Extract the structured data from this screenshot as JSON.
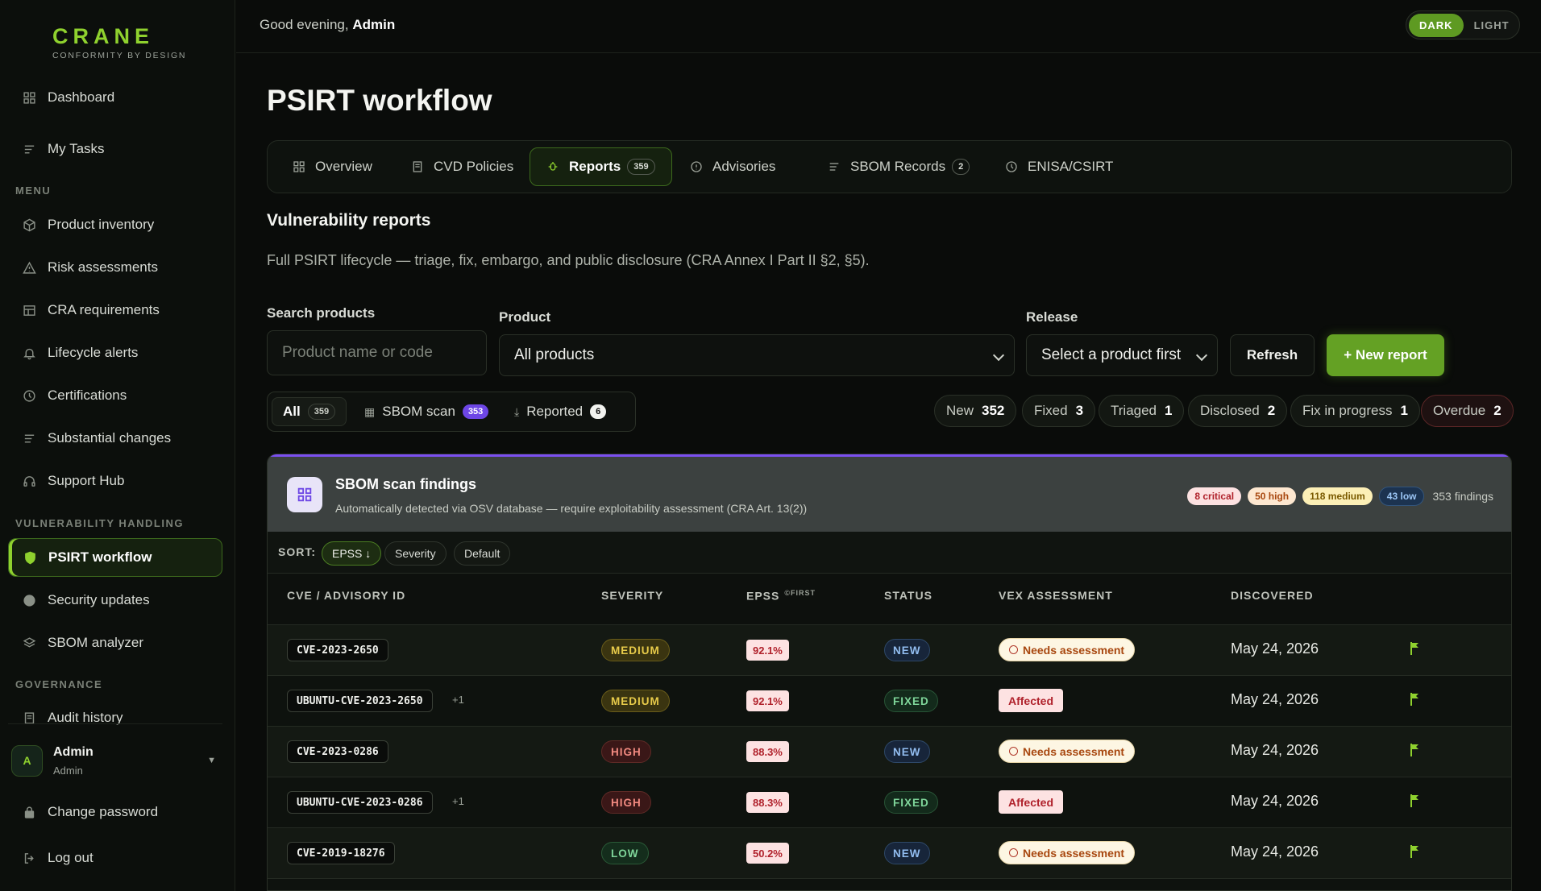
{
  "brand": {
    "name": "CRANE",
    "tagline": "CONFORMITY BY DESIGN"
  },
  "sidebar": {
    "top": [
      {
        "label": "Dashboard",
        "icon": "grid-icon"
      },
      {
        "label": "My Tasks",
        "icon": "list-icon"
      }
    ],
    "sections": [
      {
        "label": "MENU",
        "items": [
          {
            "label": "Product inventory"
          },
          {
            "label": "Risk assessments"
          },
          {
            "label": "CRA requirements"
          },
          {
            "label": "Lifecycle alerts"
          },
          {
            "label": "Certifications"
          },
          {
            "label": "Substantial changes"
          },
          {
            "label": "Support Hub"
          }
        ]
      },
      {
        "label": "VULNERABILITY HANDLING",
        "items": [
          {
            "label": "PSIRT workflow"
          },
          {
            "label": "Security updates"
          },
          {
            "label": "SBOM analyzer"
          }
        ]
      },
      {
        "label": "GOVERNANCE",
        "items": [
          {
            "label": "Audit history"
          }
        ]
      }
    ],
    "user": {
      "initial": "A",
      "name": "Admin",
      "role": "Admin"
    },
    "bottom": [
      {
        "label": "Change password"
      },
      {
        "label": "Log out"
      }
    ]
  },
  "topbar": {
    "greeting": "Good evening,",
    "user": "Admin",
    "theme": {
      "dark": "DARK",
      "light": "LIGHT",
      "selected": "DARK"
    }
  },
  "page": {
    "title": "PSIRT workflow"
  },
  "tabs": [
    {
      "label": "Overview"
    },
    {
      "label": "CVD Policies"
    },
    {
      "label": "Reports",
      "count": "359",
      "active": true
    },
    {
      "label": "Advisories"
    },
    {
      "label": "SBOM Records",
      "count": "2"
    },
    {
      "label": "ENISA/CSIRT"
    }
  ],
  "section": {
    "title": "Vulnerability reports",
    "description": "Full PSIRT lifecycle — triage, fix, embargo, and public disclosure (CRA Annex I Part II §2, §5)."
  },
  "filters": {
    "search_label": "Search products",
    "search_placeholder": "Product name or code",
    "product_label": "Product",
    "product_value": "All products",
    "release_label": "Release",
    "release_value": "Select a product first",
    "refresh": "Refresh",
    "new_report": "+ New report"
  },
  "source_tabs": [
    {
      "label": "All",
      "count": "359"
    },
    {
      "label": "SBOM scan",
      "count": "353"
    },
    {
      "label": "Reported",
      "count": "6"
    }
  ],
  "status_chips": [
    {
      "label": "New",
      "count": "352"
    },
    {
      "label": "Fixed",
      "count": "3"
    },
    {
      "label": "Triaged",
      "count": "1"
    },
    {
      "label": "Disclosed",
      "count": "2"
    },
    {
      "label": "Fix in progress",
      "count": "1"
    },
    {
      "label": "Overdue",
      "count": "2"
    }
  ],
  "findings": {
    "title": "SBOM scan findings",
    "subtitle": "Automatically detected via OSV database — require exploitability assessment (CRA Art. 13(2))",
    "critical": "8 critical",
    "high": "50 high",
    "medium": "118 medium",
    "low": "43 low",
    "total": "353 findings",
    "sort_label": "SORT:",
    "sort": [
      "EPSS ↓",
      "Severity",
      "Default"
    ],
    "columns": {
      "cve": "CVE / ADVISORY ID",
      "severity": "SEVERITY",
      "epss": "EPSS",
      "epss_sup": "©FIRST",
      "status": "STATUS",
      "vex": "VEX ASSESSMENT",
      "discovered": "DISCOVERED"
    },
    "rows": [
      {
        "id": "CVE-2023-2650",
        "extra": "",
        "severity": "MEDIUM",
        "epss": "92.1%",
        "status": "NEW",
        "vex": "Needs assessment",
        "discovered": "May 24, 2026"
      },
      {
        "id": "UBUNTU-CVE-2023-2650",
        "extra": "+1",
        "severity": "MEDIUM",
        "epss": "92.1%",
        "status": "FIXED",
        "vex": "Affected",
        "discovered": "May 24, 2026"
      },
      {
        "id": "CVE-2023-0286",
        "extra": "",
        "severity": "HIGH",
        "epss": "88.3%",
        "status": "NEW",
        "vex": "Needs assessment",
        "discovered": "May 24, 2026"
      },
      {
        "id": "UBUNTU-CVE-2023-0286",
        "extra": "+1",
        "severity": "HIGH",
        "epss": "88.3%",
        "status": "FIXED",
        "vex": "Affected",
        "discovered": "May 24, 2026"
      },
      {
        "id": "CVE-2019-18276",
        "extra": "",
        "severity": "LOW",
        "epss": "50.2%",
        "status": "NEW",
        "vex": "Needs assessment",
        "discovered": "May 24, 2026"
      }
    ]
  },
  "colors": {
    "accent": "#8fd12e",
    "primary_button": "#64a124",
    "findings_border": "#7b4ff0"
  }
}
